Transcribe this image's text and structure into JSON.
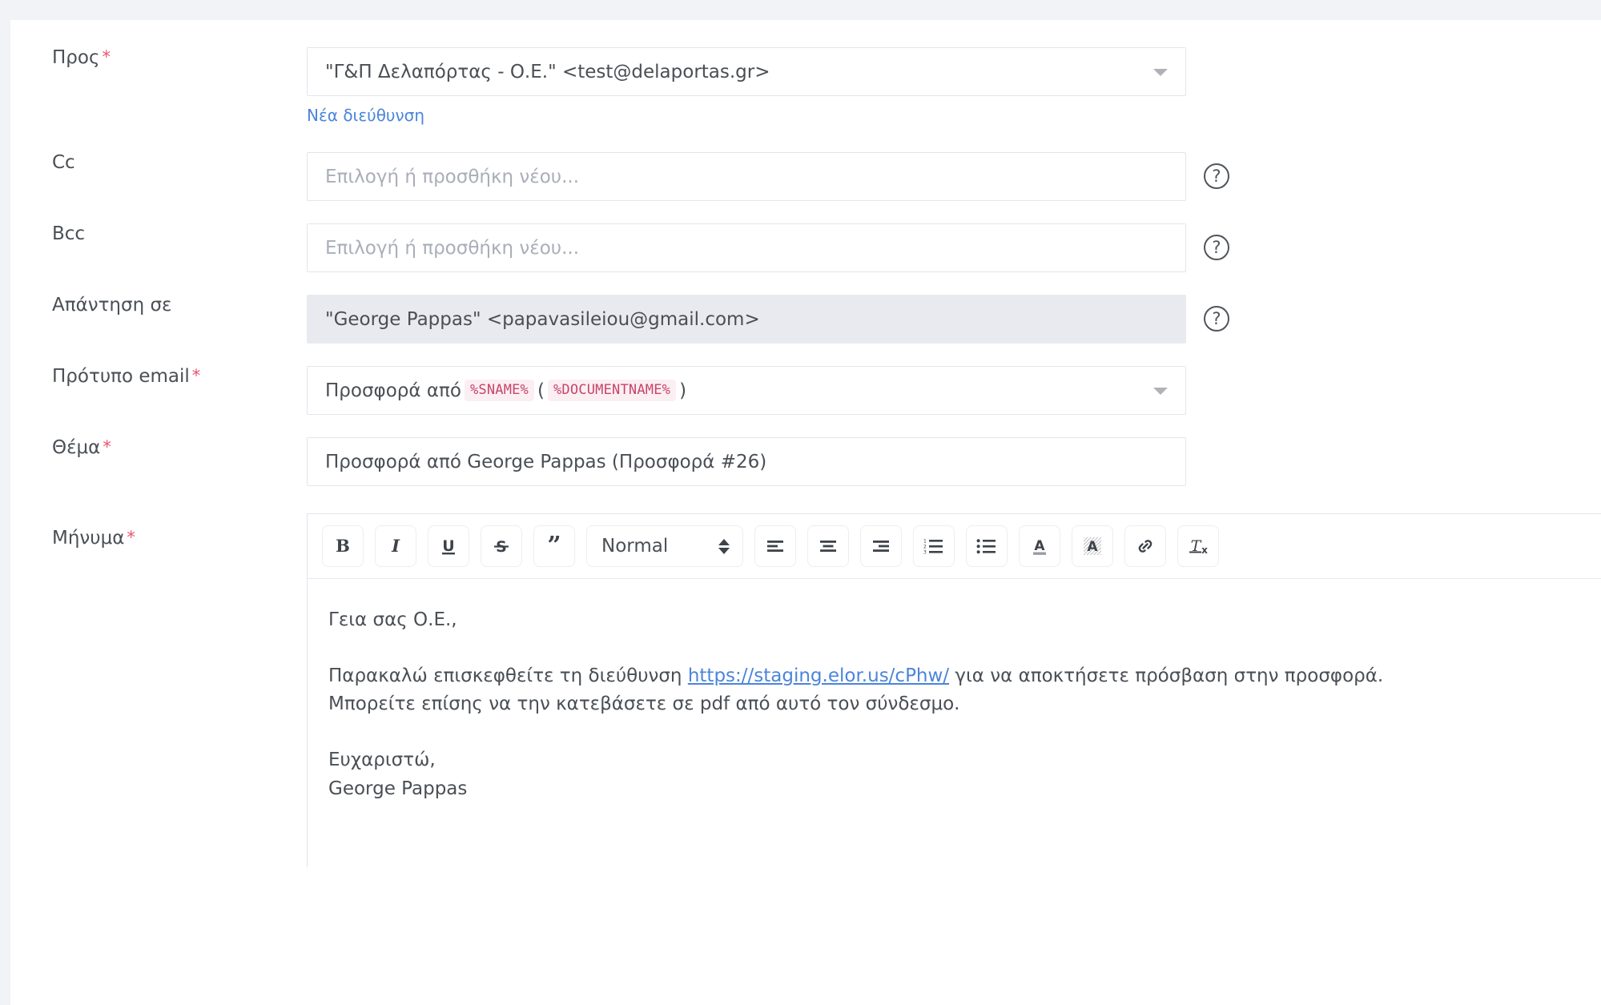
{
  "form": {
    "to": {
      "label": "Προς",
      "required": true,
      "value": "\"Γ&Π Δελαπόρτας - Ο.Ε.\" <test@delaportas.gr>",
      "type": "select",
      "new_address_link": "Νέα διεύθυνση"
    },
    "cc": {
      "label": "Cc",
      "required": false,
      "value": "",
      "placeholder": "Επιλογή ή προσθήκη νέου...",
      "help_icon": "question-mark-icon",
      "help_glyph": "?"
    },
    "bcc": {
      "label": "Bcc",
      "required": false,
      "value": "",
      "placeholder": "Επιλογή ή προσθήκη νέου...",
      "help_icon": "question-mark-icon",
      "help_glyph": "?"
    },
    "reply_to": {
      "label": "Απάντηση σε",
      "required": false,
      "value": "\"George Pappas\" <papavasileiou@gmail.com>",
      "disabled": true,
      "help_icon": "question-mark-icon",
      "help_glyph": "?"
    },
    "email_template": {
      "label": "Πρότυπο email",
      "required": true,
      "prefix": "Προσφορά από",
      "token1": "%SNAME%",
      "open_paren": "(",
      "token2": "%DOCUMENTNAME%",
      "close_paren": ")",
      "type": "select"
    },
    "subject": {
      "label": "Θέμα",
      "required": true,
      "value": "Προσφορά από George Pappas (Προσφορά #26)"
    },
    "message": {
      "label": "Μήνυμα",
      "required": true,
      "toolbar": {
        "bold": {
          "name": "bold-button",
          "label": "B"
        },
        "italic": {
          "name": "italic-button",
          "label": "I"
        },
        "underline": {
          "name": "underline-button",
          "label": "U"
        },
        "strike": {
          "name": "strikethrough-button",
          "label": "S"
        },
        "blockquote": {
          "name": "blockquote-button",
          "label": "”"
        },
        "format_select": {
          "name": "format-select",
          "value": "Normal"
        },
        "align_left": "align-left-button",
        "align_center": "align-center-button",
        "align_right": "align-right-button",
        "ordered_list": "ordered-list-button",
        "bullet_list": "bullet-list-button",
        "text_color": "text-color-button",
        "background_color": "background-color-button",
        "link": "insert-link-button",
        "clear_format": "clear-formatting-button"
      },
      "body": {
        "greeting": "Γεια σας Ο.Ε.,",
        "para_lead": "Παρακαλώ επισκεφθείτε τη διεύθυνση ",
        "link_text": "https://staging.elor.us/cPhw/",
        "para_tail": " για να αποκτήσετε πρόσβαση στην προσφορά.",
        "para_pdf": "Μπορείτε επίσης να την κατεβάσετε σε pdf από αυτό τον σύνδεσμο.",
        "closing": "Ευχαριστώ,",
        "signature": "George Pappas"
      }
    }
  },
  "colors": {
    "page_background": "#f2f3f7",
    "card_background": "#ffffff",
    "label_text": "#4a4f55",
    "required_asterisk": "#e8546b",
    "link": "#4b85da",
    "placeholder": "#a9aeb8",
    "input_border": "#e3e5ec",
    "disabled_background": "#e9eaf0",
    "token_background": "#fbeff3",
    "token_text": "#c7456c"
  }
}
